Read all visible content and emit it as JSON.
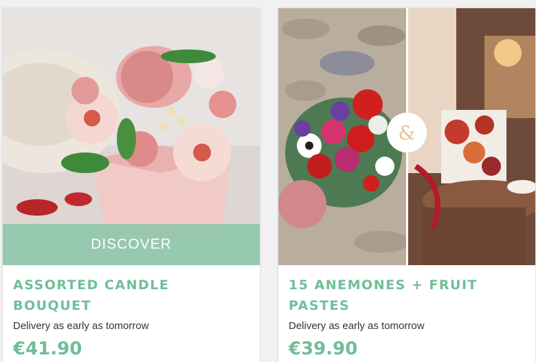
{
  "products": [
    {
      "name": "ASSORTED CANDLE BOUQUET",
      "overlay_label": "DISCOVER",
      "delivery": "Delivery as early as tomorrow",
      "price": "€41.90",
      "image": "candle-bouquet-photo"
    },
    {
      "name": "15 ANEMONES + FRUIT PASTES",
      "badge": "&",
      "delivery": "Delivery as early as tomorrow",
      "price": "€39.90",
      "image": "anemones-and-fruit-pastes-photo"
    }
  ],
  "colors": {
    "accent": "#6fbe98",
    "overlay": "#7ec4a3",
    "text": "#333333"
  }
}
